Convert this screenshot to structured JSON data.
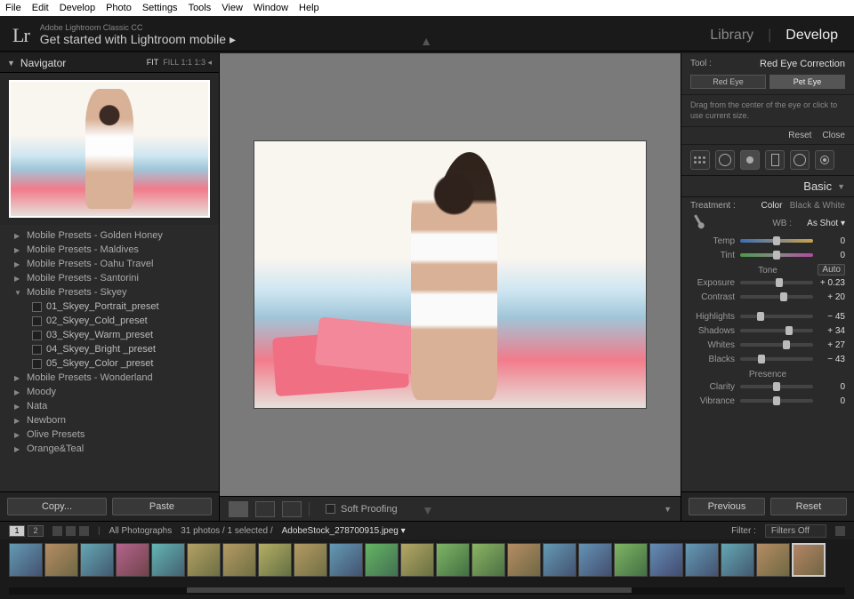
{
  "os_menu": [
    "File",
    "Edit",
    "Develop",
    "Photo",
    "Settings",
    "Tools",
    "View",
    "Window",
    "Help"
  ],
  "header": {
    "logo": "Lr",
    "subtitle": "Adobe Lightroom Classic CC",
    "title": "Get started with Lightroom mobile  ▸",
    "modules": {
      "library": "Library",
      "develop": "Develop"
    }
  },
  "navigator": {
    "title": "Navigator",
    "zoom_fit": "FIT",
    "zoom_rest": "FILL   1:1   1:3  ◂"
  },
  "presets": {
    "folders": [
      {
        "label": "Mobile Presets - Golden Honey",
        "open": false
      },
      {
        "label": "Mobile Presets - Maldives",
        "open": false
      },
      {
        "label": "Mobile Presets - Oahu Travel",
        "open": false
      },
      {
        "label": "Mobile Presets - Santorini",
        "open": false
      },
      {
        "label": "Mobile Presets - Skyey",
        "open": true,
        "items": [
          "01_Skyey_Portrait_preset",
          "02_Skyey_Cold_preset",
          "03_Skyey_Warm_preset",
          "04_Skyey_Bright _preset",
          "05_Skyey_Color _preset"
        ]
      },
      {
        "label": "Mobile Presets - Wonderland",
        "open": false
      },
      {
        "label": "Moody",
        "open": false
      },
      {
        "label": "Nata",
        "open": false
      },
      {
        "label": "Newborn",
        "open": false
      },
      {
        "label": "Olive Presets",
        "open": false
      },
      {
        "label": "Orange&Teal",
        "open": false
      }
    ],
    "copy_btn": "Copy...",
    "paste_btn": "Paste"
  },
  "center_toolbar": {
    "soft_proofing": "Soft Proofing"
  },
  "right": {
    "tool_label": "Tool :",
    "tool_name": "Red Eye Correction",
    "tabs": {
      "red_eye": "Red Eye",
      "pet_eye": "Pet Eye"
    },
    "hint": "Drag from the center of the eye or click to use current size.",
    "reset": "Reset",
    "close": "Close",
    "basic_title": "Basic",
    "treatment_label": "Treatment :",
    "treatment_color": "Color",
    "treatment_bw": "Black & White",
    "wb_label": "WB :",
    "wb_value": "As Shot ▾",
    "sliders": {
      "temp": {
        "label": "Temp",
        "value": "0",
        "pos": 50
      },
      "tint": {
        "label": "Tint",
        "value": "0",
        "pos": 50
      },
      "tone_title": "Tone",
      "auto": "Auto",
      "exposure": {
        "label": "Exposure",
        "value": "+ 0.23",
        "pos": 54
      },
      "contrast": {
        "label": "Contrast",
        "value": "+ 20",
        "pos": 60
      },
      "highlights": {
        "label": "Highlights",
        "value": "− 45",
        "pos": 28
      },
      "shadows": {
        "label": "Shadows",
        "value": "+ 34",
        "pos": 67
      },
      "whites": {
        "label": "Whites",
        "value": "+ 27",
        "pos": 63
      },
      "blacks": {
        "label": "Blacks",
        "value": "− 43",
        "pos": 29
      },
      "presence_title": "Presence",
      "clarity": {
        "label": "Clarity",
        "value": "0",
        "pos": 50
      },
      "vibrance": {
        "label": "Vibrance",
        "value": "0",
        "pos": 50
      }
    },
    "previous": "Previous",
    "reset2": "Reset"
  },
  "filter_bar": {
    "pages": [
      "1",
      "2"
    ],
    "all": "All Photographs",
    "count": "31 photos / 1 selected /",
    "filename": "AdobeStock_278700915.jpeg  ▾",
    "filter_label": "Filter :",
    "filter_value": "Filters Off"
  },
  "thumbnails_count": 23
}
